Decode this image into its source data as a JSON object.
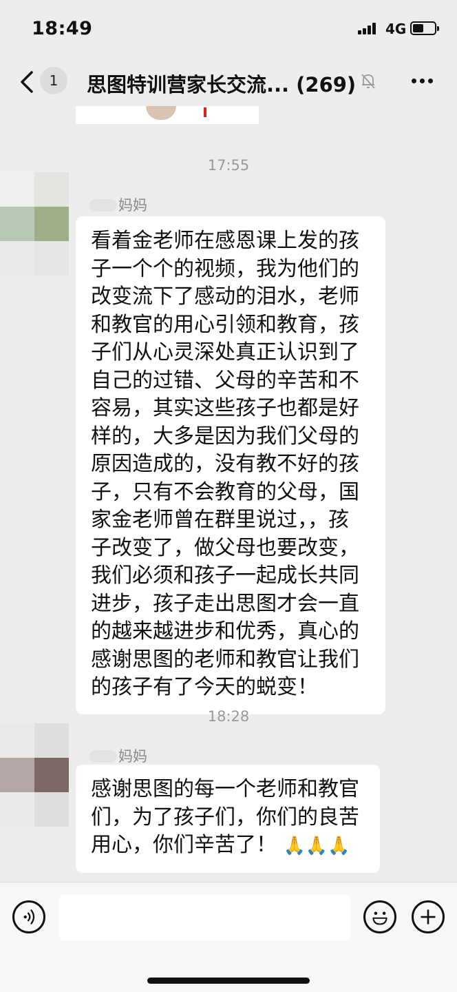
{
  "status_bar": {
    "time": "18:49",
    "network": "4G"
  },
  "nav": {
    "unread_count": "1",
    "title": "思图特训营家长交流... (269)",
    "icons": {
      "back": "chevron-left-icon",
      "mute": "bell-muted-icon",
      "more": "more-dots-icon"
    }
  },
  "chat": {
    "messages": [
      {
        "time": "17:55",
        "sender": "妈妈",
        "lines": [
          "看着金老师在感恩课上发的孩",
          "子一个个的视频，我为他们的",
          "改变流下了感动的泪水，老师",
          "和教官的用心引领和教育，孩",
          "子们从心灵深处真正认识到了",
          "自己的过错、父母的辛苦和不",
          "容易，其实这些孩子也都是好",
          "样的，大多是因为我们父母的",
          "原因造成的，没有教不好的孩",
          "子，只有不会教育的父母，国",
          "家金老师曾在群里说过，，孩",
          "子改变了，做父母也要改变，",
          "我们必须和孩子一起成长共同",
          "进步，孩子走出思图才会一直",
          "的越来越进步和优秀，真心的",
          "感谢思图的老师和教官让我们",
          "的孩子有了今天的蜕变！"
        ]
      },
      {
        "time": "18:28",
        "sender": "妈妈",
        "lines": [
          "感谢思图的每一个老师和教官",
          "们，为了孩子们，你们的良苦",
          "用心，你们辛苦了！"
        ],
        "trailing_emoji": "🙏🙏🙏"
      }
    ]
  },
  "input_bar": {
    "placeholder": "",
    "icons": {
      "voice": "voice-icon",
      "emoji": "smiley-icon",
      "plus": "plus-icon"
    }
  },
  "colors": {
    "background": "#ededed",
    "bubble": "#ffffff",
    "timestamp": "#9a9a9a",
    "sender": "#888888"
  }
}
